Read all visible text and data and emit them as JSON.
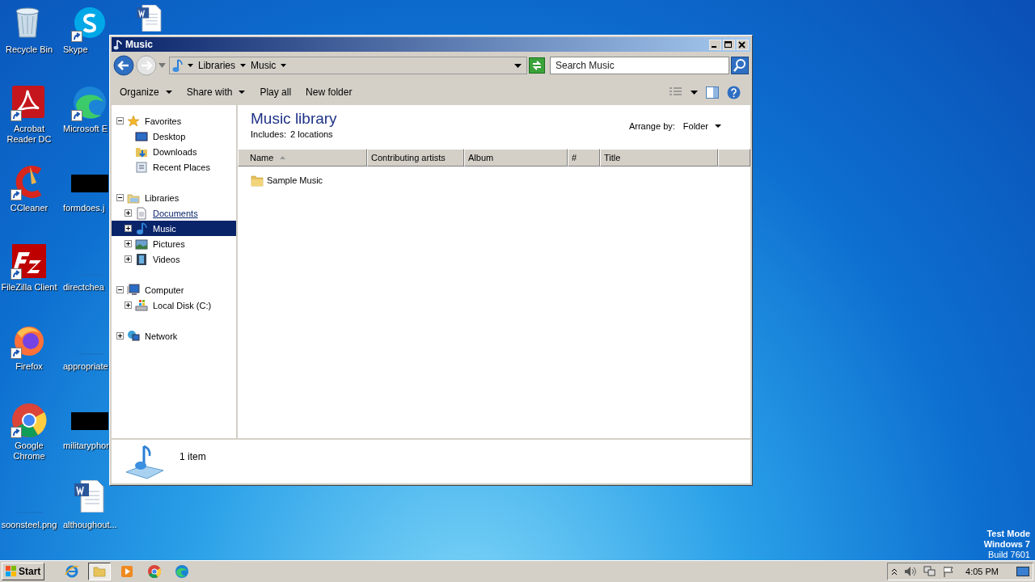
{
  "desktop": {
    "icons": [
      {
        "kind": "recycle",
        "label": "Recycle Bin",
        "shortcut": false
      },
      {
        "kind": "acrobat",
        "label": "Acrobat Reader DC",
        "shortcut": true
      },
      {
        "kind": "ccleaner",
        "label": "CCleaner",
        "shortcut": true
      },
      {
        "kind": "filezilla",
        "label": "FileZilla Client",
        "shortcut": true
      },
      {
        "kind": "firefox",
        "label": "Firefox",
        "shortcut": true
      },
      {
        "kind": "chrome",
        "label": "Google Chrome",
        "shortcut": true
      },
      {
        "kind": "blank",
        "label": "soonsteel.png",
        "shortcut": false
      },
      {
        "kind": "skype",
        "label": "Skype",
        "shortcut": true
      },
      {
        "kind": "edge",
        "label": "Microsoft E",
        "shortcut": true
      },
      {
        "kind": "black",
        "label": "formdoes.j",
        "shortcut": false
      },
      {
        "kind": "blank",
        "label": "directchea",
        "shortcut": false
      },
      {
        "kind": "blank",
        "label": "appropriate",
        "shortcut": false
      },
      {
        "kind": "black",
        "label": "militaryphon",
        "shortcut": false
      },
      {
        "kind": "word",
        "label": "althoughout...",
        "shortcut": false
      },
      {
        "kind": "word",
        "shortcut": false
      }
    ],
    "watermark": [
      "Test Mode",
      "Windows 7",
      "Build 7601"
    ]
  },
  "window": {
    "title": "Music",
    "address": {
      "crumbs": [
        "Libraries",
        "Music"
      ]
    },
    "search": {
      "placeholder": "Search Music"
    },
    "toolbar": [
      {
        "label": "Organize",
        "dropdown": true
      },
      {
        "label": "Share with",
        "dropdown": true
      },
      {
        "label": "Play all",
        "dropdown": false
      },
      {
        "label": "New folder",
        "dropdown": false
      }
    ],
    "nav": [
      {
        "kind": "star",
        "label": "Favorites",
        "expanded": true,
        "selected": false,
        "hovered": false,
        "children": [
          {
            "kind": "desktop",
            "label": "Desktop",
            "selected": false,
            "hovered": false
          },
          {
            "kind": "downloads",
            "label": "Downloads",
            "selected": false,
            "hovered": false
          },
          {
            "kind": "recent",
            "label": "Recent Places",
            "selected": false,
            "hovered": false
          }
        ]
      },
      {
        "kind": "library",
        "label": "Libraries",
        "expanded": true,
        "selected": false,
        "hovered": false,
        "children": [
          {
            "kind": "documents",
            "label": "Documents",
            "expanded": false,
            "selected": false,
            "hovered": true
          },
          {
            "kind": "music",
            "label": "Music",
            "expanded": false,
            "selected": true,
            "hovered": false
          },
          {
            "kind": "pictures",
            "label": "Pictures",
            "expanded": false,
            "selected": false,
            "hovered": false
          },
          {
            "kind": "videos",
            "label": "Videos",
            "expanded": false,
            "selected": false,
            "hovered": false
          }
        ]
      },
      {
        "kind": "computer",
        "label": "Computer",
        "expanded": true,
        "selected": false,
        "hovered": false,
        "children": [
          {
            "kind": "disk",
            "label": "Local Disk (C:)",
            "expanded": false,
            "selected": false,
            "hovered": false
          }
        ]
      },
      {
        "kind": "network",
        "label": "Network",
        "expanded": false,
        "selected": false,
        "hovered": false
      }
    ],
    "library": {
      "title": "Music library",
      "includes_label": "Includes:",
      "includes_value": "2 locations",
      "arrange_label": "Arrange by:",
      "arrange_value": "Folder"
    },
    "columns": [
      {
        "label": "Name",
        "sorted": true
      },
      {
        "label": "Contributing artists",
        "sorted": false
      },
      {
        "label": "Album",
        "sorted": false
      },
      {
        "label": "#",
        "sorted": false
      },
      {
        "label": "Title",
        "sorted": false
      },
      {
        "sorted": false
      }
    ],
    "rows": [
      {
        "kind": "folder",
        "name": "Sample Music",
        "selected": false
      }
    ],
    "details": {
      "count": "1 item"
    }
  },
  "taskbar": {
    "start": "Start",
    "apps": [
      {
        "kind": "ie",
        "active": false
      },
      {
        "kind": "explorer",
        "active": true
      },
      {
        "kind": "media",
        "active": false
      },
      {
        "kind": "chrome",
        "active": false
      },
      {
        "kind": "edge",
        "active": false
      }
    ],
    "clock": "4:05 PM"
  }
}
